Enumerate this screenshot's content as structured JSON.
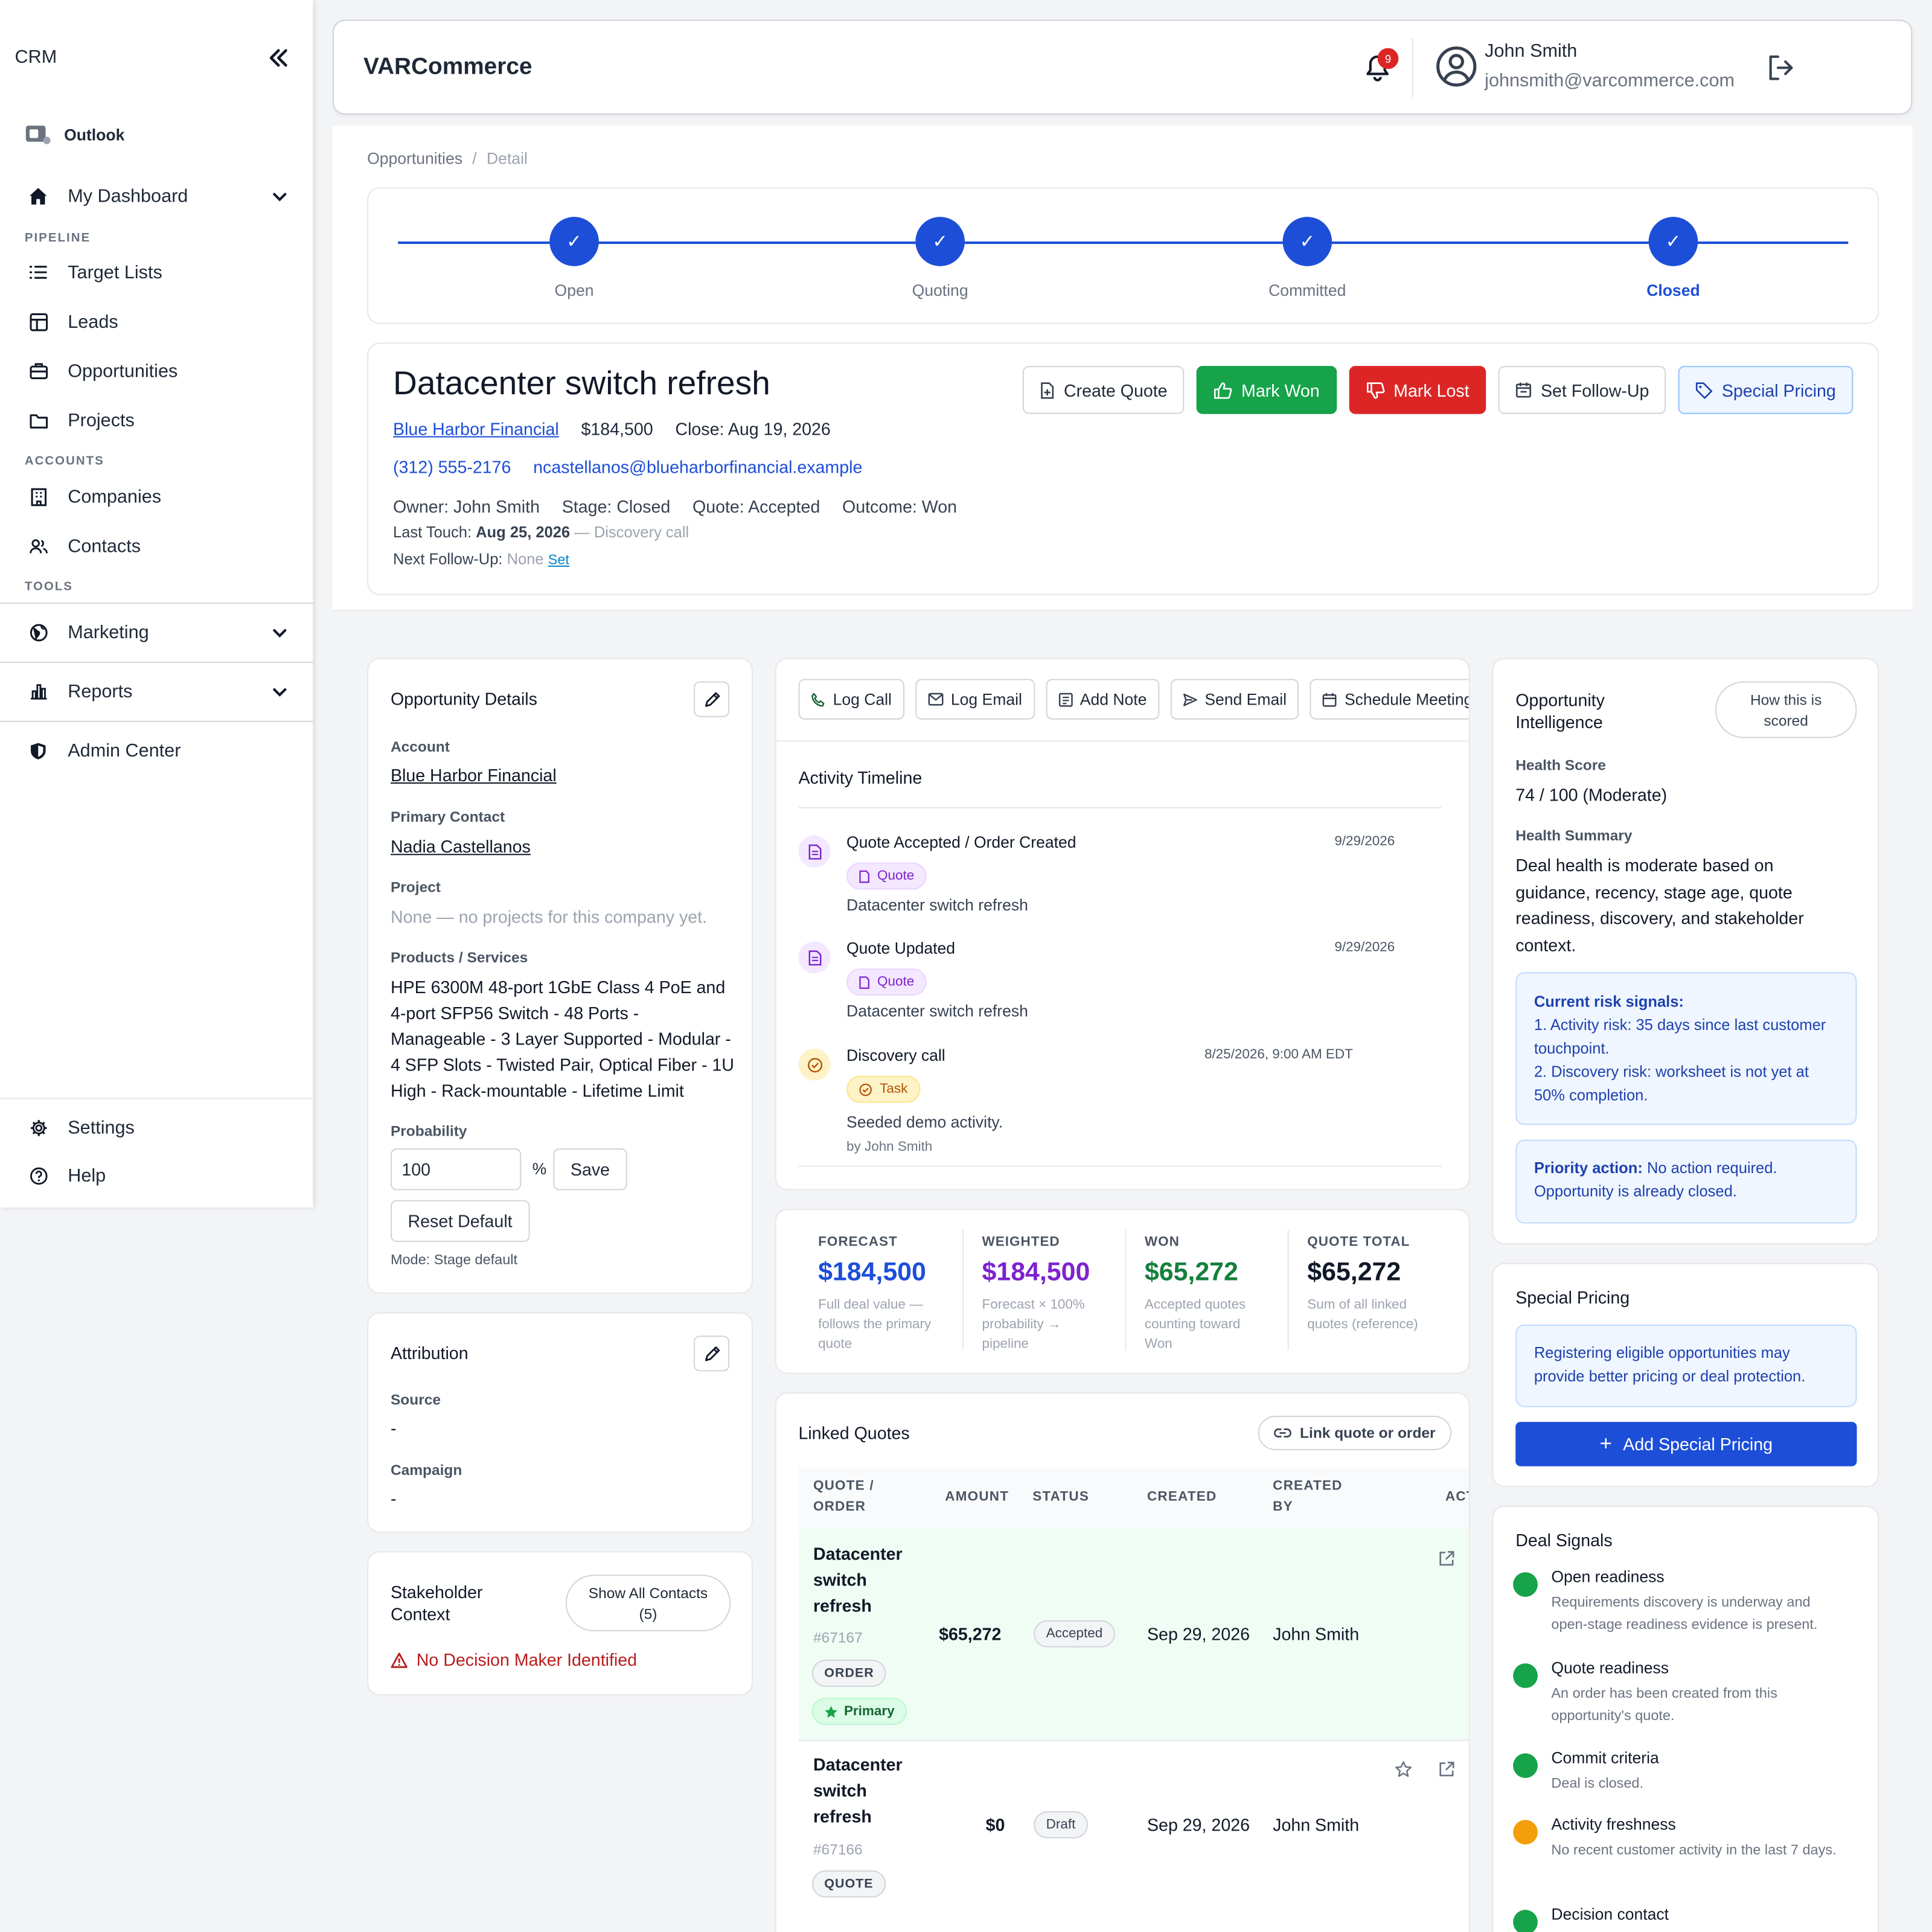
{
  "sidebar": {
    "brand": "CRM",
    "outlook": "Outlook",
    "dashboard": "My Dashboard",
    "section_pipeline": "PIPELINE",
    "target_lists": "Target Lists",
    "leads": "Leads",
    "opportunities": "Opportunities",
    "projects": "Projects",
    "section_accounts": "ACCOUNTS",
    "companies": "Companies",
    "contacts": "Contacts",
    "section_tools": "TOOLS",
    "marketing": "Marketing",
    "reports": "Reports",
    "admin_center": "Admin Center",
    "settings": "Settings",
    "help": "Help"
  },
  "header": {
    "title": "VARCommerce",
    "notification_count": "9",
    "user_name": "John Smith",
    "user_email": "johnsmith@varcommerce.com"
  },
  "breadcrumb": {
    "parent": "Opportunities",
    "separator": "/",
    "current": "Detail"
  },
  "stages": [
    {
      "label": "Open",
      "check": "✓",
      "active": false
    },
    {
      "label": "Quoting",
      "check": "✓",
      "active": false
    },
    {
      "label": "Committed",
      "check": "✓",
      "active": false
    },
    {
      "label": "Closed",
      "check": "✓",
      "active": true
    }
  ],
  "opportunity": {
    "title": "Datacenter switch refresh",
    "account": "Blue Harbor Financial",
    "amount": "$184,500",
    "close": "Close: Aug 19, 2026",
    "phone": "(312) 555-2176",
    "email": "ncastellanos@blueharborfinancial.example",
    "owner": "Owner: John Smith",
    "stage": "Stage: Closed",
    "quote": "Quote: Accepted",
    "outcome": "Outcome: Won",
    "last_touch_label": "Last Touch:",
    "last_touch_date": "Aug 25, 2026",
    "last_touch_note": "— Discovery call",
    "next_followup_label": "Next Follow-Up:",
    "next_followup_value": "None",
    "next_followup_link": "Set"
  },
  "actions": {
    "create_quote": "Create Quote",
    "mark_won": "Mark Won",
    "mark_lost": "Mark Lost",
    "set_followup": "Set Follow-Up",
    "special_pricing": "Special Pricing"
  },
  "details": {
    "title": "Opportunity Details",
    "account_label": "Account",
    "account_value": "Blue Harbor Financial",
    "primary_contact_label": "Primary Contact",
    "primary_contact_value": "Nadia Castellanos",
    "project_label": "Project",
    "project_value": "None — no projects for this company yet.",
    "products_label": "Products / Services",
    "products_value": "HPE 6300M 48-port 1GbE Class 4 PoE and 4-port SFP56 Switch - 48 Ports - Manageable - 3 Layer Supported - Modular - 4 SFP Slots - Twisted Pair, Optical Fiber - 1U High - Rack-mountable - Lifetime Limit",
    "probability_label": "Probability",
    "probability_value": "100",
    "percent": "%",
    "save": "Save",
    "reset_default": "Reset Default",
    "mode": "Mode: Stage default"
  },
  "attribution": {
    "title": "Attribution",
    "source_label": "Source",
    "source_value": "-",
    "campaign_label": "Campaign",
    "campaign_value": "-"
  },
  "stakeholder": {
    "title": "Stakeholder Context",
    "show_all": "Show All Contacts (5)",
    "warning": "No Decision Maker Identified"
  },
  "activity": {
    "log_call": "Log Call",
    "log_email": "Log Email",
    "add_note": "Add Note",
    "send_email": "Send Email",
    "schedule_meeting": "Schedule Meeting",
    "timeline_title": "Activity Timeline",
    "items": [
      {
        "title": "Quote Accepted / Order Created",
        "date": "9/29/2026",
        "chip": "Quote",
        "desc": "Datacenter switch refresh"
      },
      {
        "title": "Quote Updated",
        "date": "9/29/2026",
        "chip": "Quote",
        "desc": "Datacenter switch refresh"
      },
      {
        "title": "Discovery call",
        "date": "8/25/2026, 9:00 AM EDT",
        "chip": "Task",
        "desc": "Seeded demo activity.",
        "by": "by John Smith"
      }
    ]
  },
  "metrics": [
    {
      "label": "FORECAST",
      "value": "$184,500",
      "desc": "Full deal value — follows the primary quote",
      "color": "#1d4ed8"
    },
    {
      "label": "WEIGHTED",
      "value": "$184,500",
      "desc": "Forecast × 100% probability → pipeline",
      "color": "#7e22ce"
    },
    {
      "label": "WON",
      "value": "$65,272",
      "desc": "Accepted quotes counting toward Won",
      "color": "#15803d"
    },
    {
      "label": "QUOTE TOTAL",
      "value": "$65,272",
      "desc": "Sum of all linked quotes (reference)",
      "color": "#111827"
    }
  ],
  "linked_quotes": {
    "title": "Linked Quotes",
    "link_button": "Link quote or order",
    "columns": [
      "QUOTE / ORDER",
      "AMOUNT",
      "STATUS",
      "CREATED",
      "CREATED BY",
      "ACTIONS"
    ],
    "rows": [
      {
        "name": "Datacenter switch refresh",
        "id": "#67167",
        "type": "ORDER",
        "primary": "Primary",
        "amount": "$65,272",
        "status": "Accepted",
        "created": "Sep 29, 2026",
        "created_by": "John Smith"
      },
      {
        "name": "Datacenter switch refresh",
        "id": "#67166",
        "type": "QUOTE",
        "amount": "$0",
        "status": "Draft",
        "created": "Sep 29, 2026",
        "created_by": "John Smith"
      }
    ]
  },
  "intelligence": {
    "title": "Opportunity Intelligence",
    "how_scored": "How this is scored",
    "health_score_label": "Health Score",
    "health_score_value": "74 / 100 (Moderate)",
    "health_summary_label": "Health Summary",
    "health_summary_value": "Deal health is moderate based on guidance, recency, stage age, quote readiness, discovery, and stakeholder context.",
    "risk_title": "Current risk signals:",
    "risk_1": "1. Activity risk: 35 days since last customer touchpoint.",
    "risk_2": "2. Discovery risk: worksheet is not yet at 50% completion.",
    "priority_label": "Priority action:",
    "priority_value": "No action required. Opportunity is already closed."
  },
  "special_pricing": {
    "title": "Special Pricing",
    "info": "Registering eligible opportunities may provide better pricing or deal protection.",
    "add_button": "Add Special Pricing",
    "plus": "+"
  },
  "deal_signals": {
    "title": "Deal Signals",
    "items": [
      {
        "title": "Open readiness",
        "desc": "Requirements discovery is underway and open-stage readiness evidence is present.",
        "color": "#16a34a"
      },
      {
        "title": "Quote readiness",
        "desc": "An order has been created from this opportunity's quote.",
        "color": "#16a34a"
      },
      {
        "title": "Commit criteria",
        "desc": "Deal is closed.",
        "color": "#16a34a"
      },
      {
        "title": "Activity freshness",
        "desc": "No recent customer activity in the last 7 days.",
        "color": "#f59e0b"
      },
      {
        "title": "Decision contact",
        "desc": "",
        "color": "#16a34a"
      }
    ]
  }
}
